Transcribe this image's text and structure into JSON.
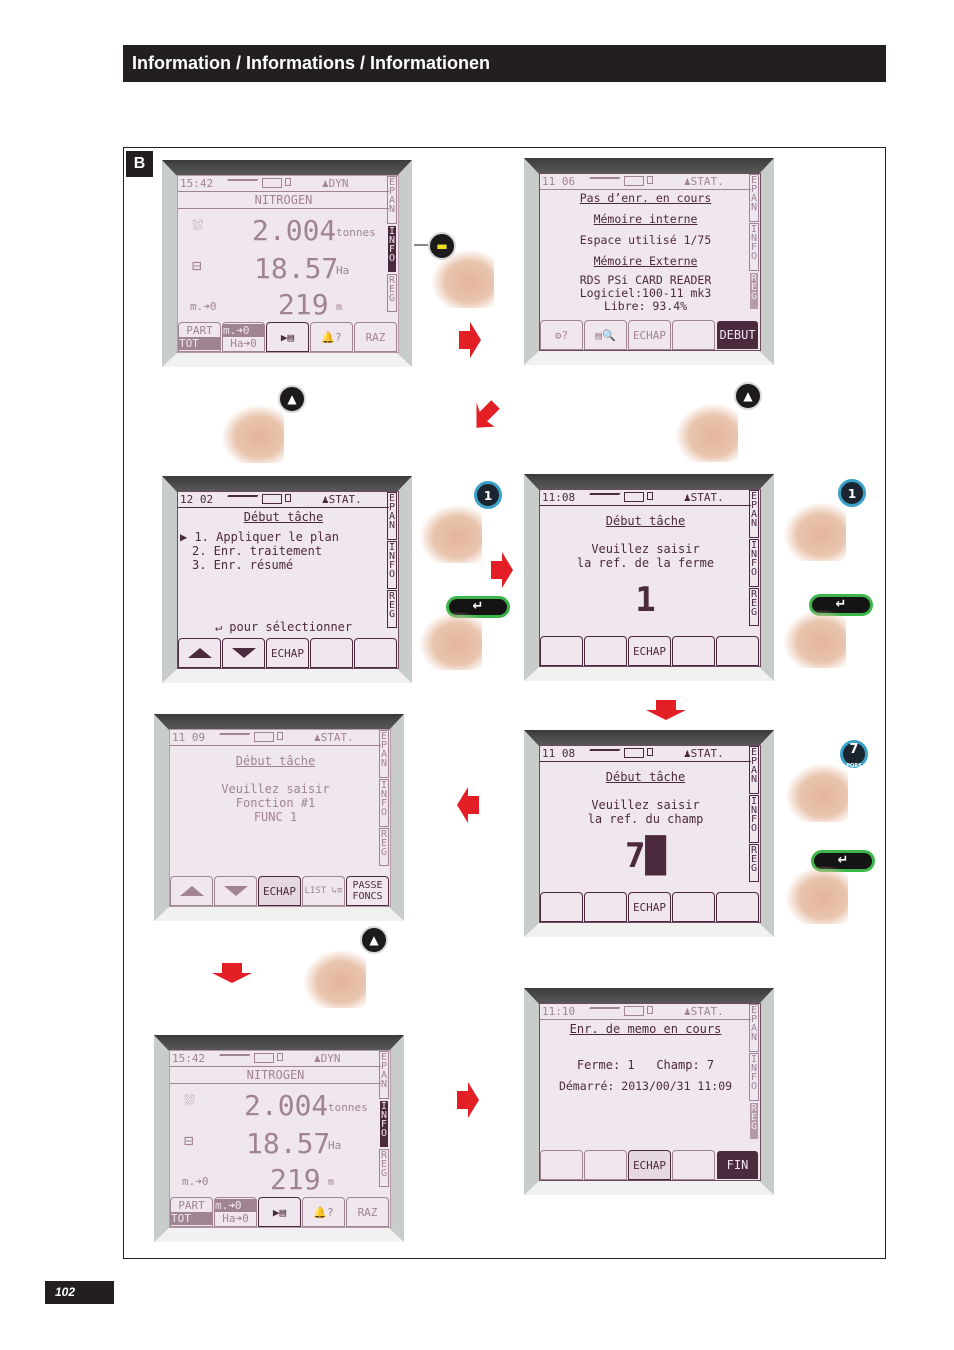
{
  "header": {
    "title": "Information / Informations / Informationen"
  },
  "panel": {
    "label": "B"
  },
  "page_number": "102",
  "colors": {
    "lcd_bg": "#f0e6ee",
    "lcd_ink": "#4c2a3e",
    "arrow_red": "#e31e24",
    "enter_green": "#3cb54a",
    "numkey_blue": "#3aa0c8"
  },
  "side_tabs": [
    "EPAN",
    "INFO",
    "REG"
  ],
  "screens": {
    "s1": {
      "time": "15:42",
      "mode": "DYN",
      "title": "NITROGEN",
      "active_tab": "INFO",
      "rows": [
        {
          "icon": "spreader-icon",
          "value": "2.004",
          "unit": "tonnes"
        },
        {
          "icon": "field-area-icon",
          "value": "18.57",
          "unit": "Ha"
        },
        {
          "label": "m.➜0",
          "value": "219",
          "unit": "m"
        }
      ],
      "keys": {
        "part": "PART",
        "tot": "TOT",
        "m_reset": "m.➜0",
        "ha_reset": "Ha➜0",
        "next": "▶▤",
        "alarm": "🔔?",
        "raz": "RAZ"
      }
    },
    "s2": {
      "time": "11 06",
      "mode": "STAT.",
      "active_tab": "REG",
      "lines": [
        "Pas d’enr. en cours",
        "Mémoire interne",
        "Espace utilisé 1/75",
        "Mémoire Externe",
        "RDS PSi CARD READER",
        "Logiciel:100-11 mk3",
        "Libre: 93.4%"
      ],
      "keys": [
        "⚙?",
        "▤🔍",
        "ECHAP",
        "",
        "DEBUT"
      ]
    },
    "s3": {
      "time": "12 02",
      "mode": "STAT.",
      "title": "Début tâche",
      "menu": [
        "1. Appliquer le plan",
        "2. Enr. traitement",
        "3. Enr. résumé"
      ],
      "hint": "↵ pour sélectionner",
      "keys": [
        "▲",
        "▼",
        "ECHAP",
        "",
        ""
      ]
    },
    "s4": {
      "time": "11:08",
      "mode": "STAT.",
      "title": "Début tâche",
      "prompt1": "Veuillez saisir",
      "prompt2": "la ref. de la ferme",
      "value": "1",
      "keys": [
        "",
        "",
        "ECHAP",
        "",
        ""
      ]
    },
    "s5": {
      "time": "11 09",
      "mode": "STAT.",
      "title": "Début tâche",
      "prompt1": "Veuillez saisir",
      "prompt2": "Fonction #1",
      "prompt3": "FUNC 1",
      "keys": [
        "▲",
        "▼",
        "ECHAP",
        "LIST ↳≡",
        "PASSE FONCS"
      ]
    },
    "s6": {
      "time": "11 08",
      "mode": "STAT.",
      "title": "Début tâche",
      "prompt1": "Veuillez saisir",
      "prompt2": "la ref. du champ",
      "value": "7█",
      "keys": [
        "",
        "",
        "ECHAP",
        "",
        ""
      ]
    },
    "s7": {
      "time": "15:42",
      "mode": "DYN",
      "title": "NITROGEN",
      "active_tab": "INFO",
      "rows": [
        {
          "icon": "spreader-icon",
          "value": "2.004",
          "unit": "tonnes"
        },
        {
          "icon": "field-area-icon",
          "value": "18.57",
          "unit": "Ha"
        },
        {
          "label": "m.➜0",
          "value": "219",
          "unit": "m"
        }
      ],
      "keys": {
        "part": "PART",
        "tot": "TOT",
        "m_reset": "m.➜0",
        "ha_reset": "Ha➜0",
        "next": "▶▤",
        "alarm": "🔔?",
        "raz": "RAZ"
      }
    },
    "s8": {
      "time": "11:10",
      "mode": "STAT.",
      "title": "Enr. de memo en cours",
      "line1": "Ferme: 1   Champ: 7",
      "line2": "Démarré: 2013/00/31 11:09",
      "keys": [
        "",
        "",
        "ECHAP",
        "",
        "FIN"
      ]
    }
  },
  "buttons": {
    "num1": "1",
    "num7": "7",
    "num7_sub": "PQRS",
    "enter": "↵",
    "up": "▲",
    "info": "▬"
  }
}
